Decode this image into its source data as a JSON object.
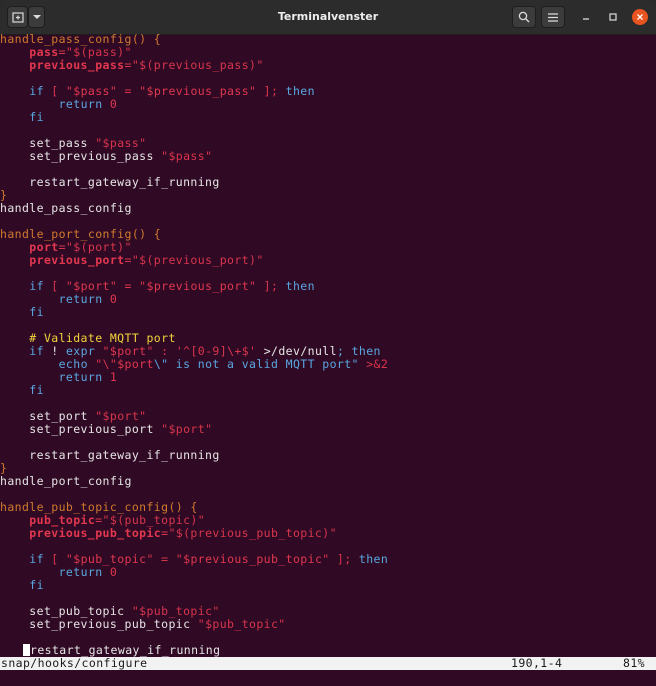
{
  "window": {
    "title": "Terminalvenster",
    "icons": [
      "new-tab-icon",
      "chevron-down-icon",
      "search-icon",
      "hamburger-menu-icon",
      "minimize-icon",
      "maximize-icon",
      "close-icon"
    ]
  },
  "colors": {
    "terminal_bg": "#300a24",
    "function": "#d07a2e",
    "variable": "#e2374f",
    "keyword": "#5aa6e0",
    "comment": "#f2d43a",
    "close_button": "#e95420"
  },
  "code": {
    "l1a": "handle_pass_config() {",
    "l2a": "    ",
    "l2b": "pass",
    "l2c": "=\"$(pass)\"",
    "l3a": "    ",
    "l3b": "previous_pass",
    "l3c": "=\"$(previous_pass)\"",
    "l5a": "    ",
    "l5b": "if",
    "l5c": " [ \"",
    "l5d": "$pass",
    "l5e": "\" = \"",
    "l5f": "$previous_pass",
    "l5g": "\" ];",
    "l5h": " then",
    "l6a": "        ",
    "l6b": "return",
    "l6c": " 0",
    "l7a": "    ",
    "l7b": "fi",
    "l9a": "    set_pass ",
    "l9b": "\"$pass\"",
    "l10a": "    set_previous_pass ",
    "l10b": "\"$pass\"",
    "l12a": "    restart_gateway_if_running",
    "l13a": "}",
    "l14a": "handle_pass_config",
    "l16a": "handle_port_config() {",
    "l17a": "    ",
    "l17b": "port",
    "l17c": "=\"$(port)\"",
    "l18a": "    ",
    "l18b": "previous_port",
    "l18c": "=\"$(previous_port)\"",
    "l20a": "    ",
    "l20b": "if",
    "l20c": " [ \"",
    "l20d": "$port",
    "l20e": "\" = \"",
    "l20f": "$previous_port",
    "l20g": "\" ];",
    "l20h": " then",
    "l21a": "        ",
    "l21b": "return",
    "l21c": " 0",
    "l22a": "    ",
    "l22b": "fi",
    "l24a": "    # Validate MQTT port",
    "l25a": "    ",
    "l25b": "if",
    "l25c": " ! ",
    "l25d": "expr",
    "l25e": " \"",
    "l25f": "$port",
    "l25g": "\" : ",
    "l25h": "'^[0-9]\\+$'",
    "l25i": " >/dev/null",
    "l25j": ";",
    "l25k": " then",
    "l26a": "        ",
    "l26b": "echo",
    "l26c": " \"\\\"",
    "l26d": "$port",
    "l26e": "\\\" is not a valid MQTT port\"",
    "l26f": " >&2",
    "l27a": "        ",
    "l27b": "return",
    "l27c": " 1",
    "l28a": "    ",
    "l28b": "fi",
    "l30a": "    set_port ",
    "l30b": "\"$port\"",
    "l31a": "    set_previous_port ",
    "l31b": "\"$port\"",
    "l33a": "    restart_gateway_if_running",
    "l34a": "}",
    "l35a": "handle_port_config",
    "l37a": "handle_pub_topic_config() {",
    "l38a": "    ",
    "l38b": "pub_topic",
    "l38c": "=\"$(pub_topic)\"",
    "l39a": "    ",
    "l39b": "previous_pub_topic",
    "l39c": "=\"$(previous_pub_topic)\"",
    "l41a": "    ",
    "l41b": "if",
    "l41c": " [ \"",
    "l41d": "$pub_topic",
    "l41e": "\" = \"",
    "l41f": "$previous_pub_topic",
    "l41g": "\" ];",
    "l41h": " then",
    "l42a": "        ",
    "l42b": "return",
    "l42c": " 0",
    "l43a": "    ",
    "l43b": "fi",
    "l45a": "    set_pub_topic ",
    "l45b": "\"$pub_topic\"",
    "l46a": "    set_previous_pub_topic ",
    "l46b": "\"$pub_topic\"",
    "l48a": "    ",
    "l48b": "restart_gateway_if_running"
  },
  "status": {
    "file": "snap/hooks/configure",
    "position": "190,1-4",
    "percent": "81%"
  }
}
